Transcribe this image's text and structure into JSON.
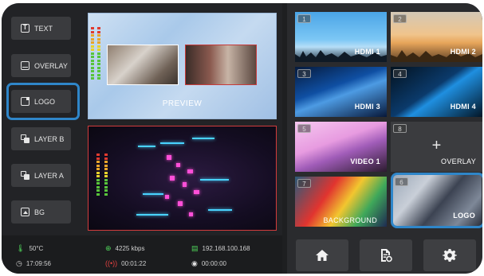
{
  "layers": [
    {
      "label": "TEXT",
      "icon": "text-icon"
    },
    {
      "label": "OVERLAY",
      "icon": "overlay-icon"
    },
    {
      "label": "LOGO",
      "icon": "logo-icon"
    },
    {
      "label": "LAYER B",
      "icon": "layers-icon"
    },
    {
      "label": "LAYER A",
      "icon": "layers-icon"
    },
    {
      "label": "BG",
      "icon": "image-icon"
    }
  ],
  "preview": {
    "label": "PREVIEW"
  },
  "status": {
    "temperature": "50°C",
    "clock": "17:09:56",
    "bitrate": "4225 kbps",
    "stream_time": "00:01:22",
    "ip": "192.168.100.168",
    "record_time": "00:00:00"
  },
  "sources": [
    {
      "num": "1",
      "label": "HDMI 1"
    },
    {
      "num": "2",
      "label": "HDMI 2"
    },
    {
      "num": "3",
      "label": "HDMI 3"
    },
    {
      "num": "4",
      "label": "HDMI 4"
    },
    {
      "num": "5",
      "label": "VIDEO 1"
    },
    {
      "num": "8",
      "label": "OVERLAY"
    },
    {
      "num": "7",
      "label": "BACKGROUND"
    },
    {
      "num": "6",
      "label": "LOGO"
    }
  ],
  "colors": {
    "accent": "#2f86c9",
    "program_border": "#d23c3c",
    "panel": "#222326"
  }
}
